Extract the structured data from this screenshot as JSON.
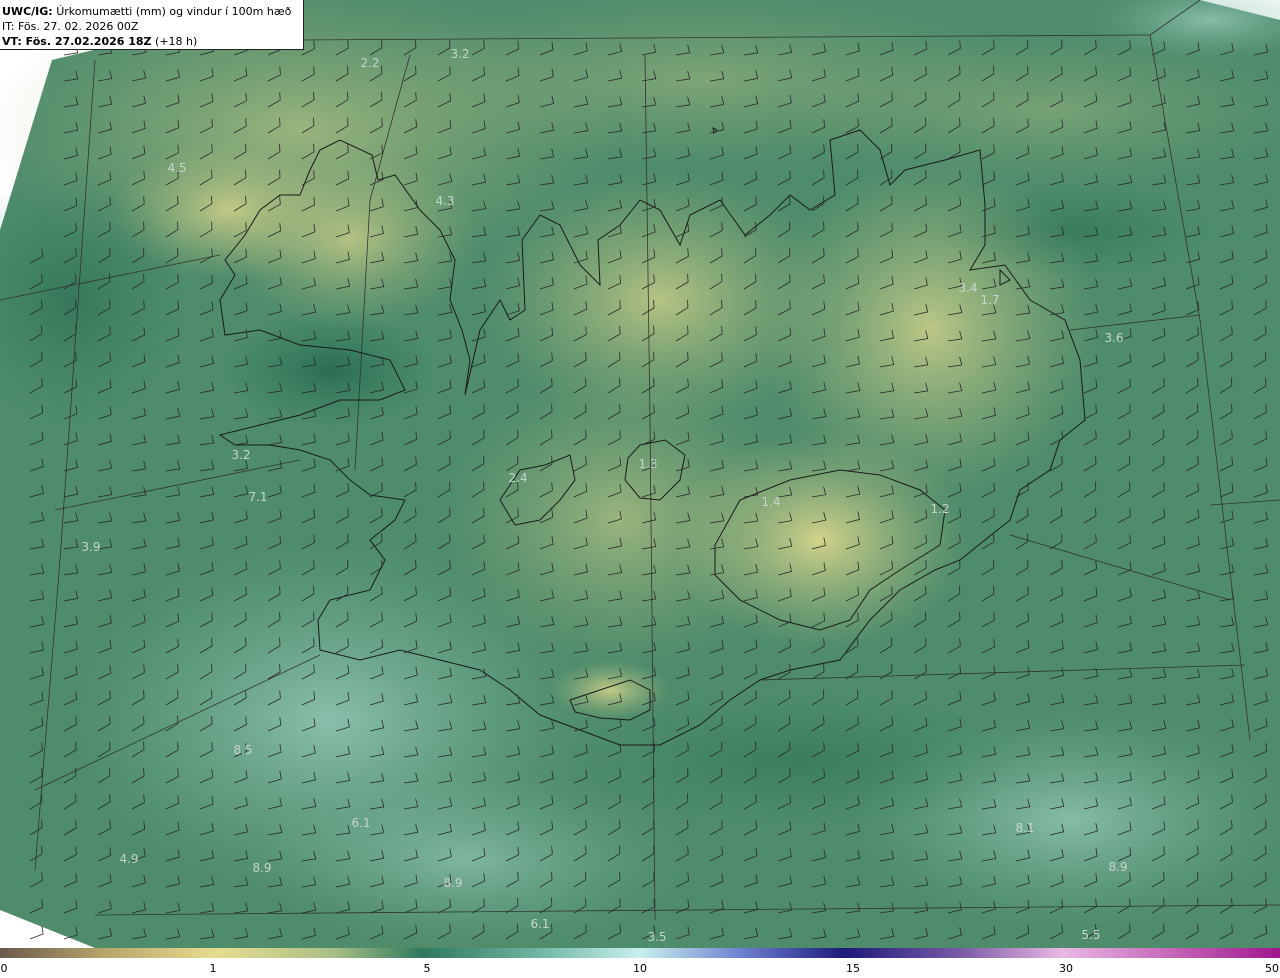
{
  "header": {
    "product_prefix": "UWC/IG:",
    "product_title": "Úrkomumætti (mm) og vindur í 100m hæð",
    "init_time": "IT: Fös. 27. 02. 2026 00Z",
    "valid_prefix": "VT: Fös. 27.02.2026 18Z",
    "valid_suffix": "(+18 h)"
  },
  "colors": {
    "background_low": "#2f7a5e",
    "background_mid": "#5e9a72",
    "land_high": "#d9d68a",
    "ocean_light": "#86bfae",
    "coastline": "#1a1a1a",
    "grid": "#333333"
  },
  "value_labels": [
    {
      "text": "2.2"
    },
    {
      "text": "3.2"
    },
    {
      "text": "4.5"
    },
    {
      "text": "4.3"
    },
    {
      "text": "3.4"
    },
    {
      "text": "1.7"
    },
    {
      "text": "3.6"
    },
    {
      "text": "3.2"
    },
    {
      "text": "7.1"
    },
    {
      "text": "3.9"
    },
    {
      "text": "2.4"
    },
    {
      "text": "1.3"
    },
    {
      "text": "1.4"
    },
    {
      "text": "1.2"
    },
    {
      "text": "8.5"
    },
    {
      "text": "6.1"
    },
    {
      "text": "4.9"
    },
    {
      "text": "8.9"
    },
    {
      "text": "8.9"
    },
    {
      "text": "6.1"
    },
    {
      "text": "8.1"
    },
    {
      "text": "8.9"
    },
    {
      "text": "5.5"
    },
    {
      "text": "3.5"
    }
  ],
  "colorbar": {
    "ticks": [
      "0",
      "1",
      "5",
      "10",
      "15",
      "30",
      "50"
    ]
  }
}
